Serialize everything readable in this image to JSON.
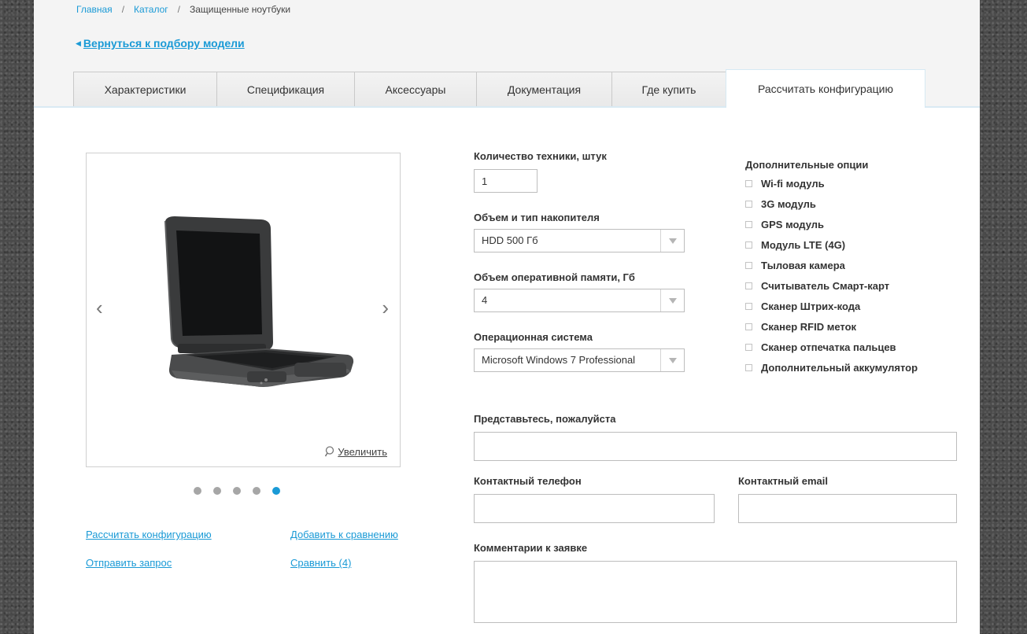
{
  "breadcrumb": {
    "items": [
      "Главная",
      "Каталог"
    ],
    "separator": "/",
    "current": "Защищенные ноутбуки"
  },
  "back_link": "Вернуться к подбору модели",
  "tabs": [
    {
      "label": "Характеристики"
    },
    {
      "label": "Спецификация"
    },
    {
      "label": "Аксессуары"
    },
    {
      "label": "Документация"
    },
    {
      "label": "Где купить"
    },
    {
      "label": "Рассчитать конфигурацию",
      "active": true
    }
  ],
  "gallery": {
    "prev_glyph": "‹",
    "next_glyph": "›",
    "zoom_label": "Увеличить",
    "slide_count": 5,
    "active_slide": 5
  },
  "actions": {
    "calc_config": "Рассчитать конфигурацию",
    "add_compare": "Добавить к сравнению",
    "send_request": "Отправить запрос",
    "compare": "Сравнить (4)"
  },
  "form": {
    "quantity": {
      "label": "Количество техники, штук",
      "value": "1"
    },
    "storage": {
      "label": "Объем и тип накопителя",
      "value": "HDD 500 Гб"
    },
    "ram": {
      "label": "Объем оперативной памяти, Гб",
      "value": "4"
    },
    "os": {
      "label": "Операционная система",
      "value": "Microsoft Windows 7 Professional"
    },
    "name": {
      "label": "Представьтесь, пожалуйста",
      "value": ""
    },
    "phone": {
      "label": "Контактный телефон",
      "value": ""
    },
    "email": {
      "label": "Контактный email",
      "value": ""
    },
    "comments": {
      "label": "Комментарии к заявке",
      "value": ""
    }
  },
  "options": {
    "title": "Дополнительные опции",
    "items": [
      {
        "label": "Wi-fi модуль",
        "checked": false
      },
      {
        "label": "3G модуль",
        "checked": false
      },
      {
        "label": "GPS модуль",
        "checked": false
      },
      {
        "label": "Модуль LTE (4G)",
        "checked": false
      },
      {
        "label": "Тыловая камера",
        "checked": false
      },
      {
        "label": "Считыватель Смарт-карт",
        "checked": false
      },
      {
        "label": "Сканер Штрих-кода",
        "checked": false
      },
      {
        "label": "Сканер RFID меток",
        "checked": false
      },
      {
        "label": "Сканер отпечатка пальцев",
        "checked": false
      },
      {
        "label": "Дополнительный аккумулятор",
        "checked": false
      }
    ]
  },
  "colors": {
    "accent": "#1a9ad6",
    "tab_border": "#c9c9c9",
    "top_bg": "#f4f4f4"
  }
}
